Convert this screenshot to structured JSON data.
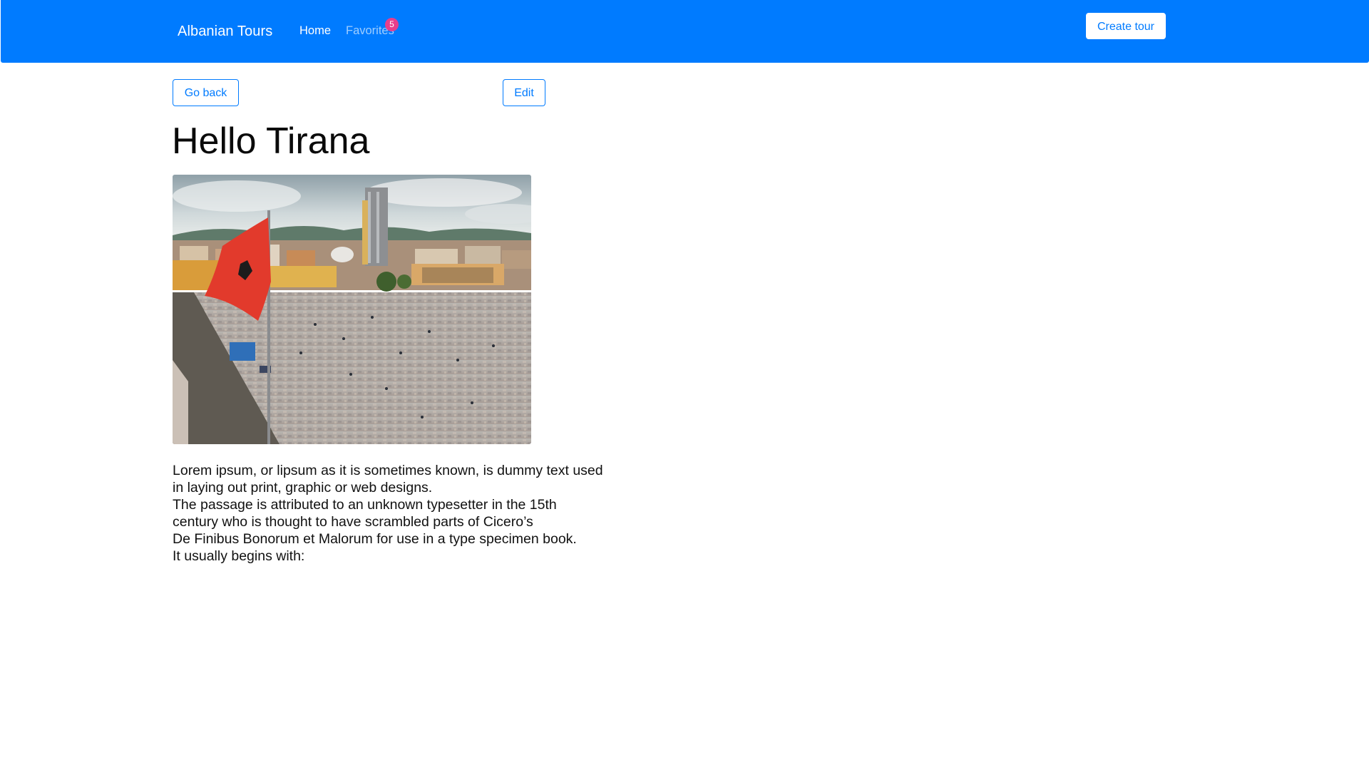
{
  "navbar": {
    "brand": "Albanian Tours",
    "links": [
      {
        "label": "Home",
        "active": true
      },
      {
        "label": "Favorites",
        "active": false
      }
    ],
    "favorites_count": "5",
    "create_button": "Create tour",
    "color": "#007bff",
    "badge_color": "#e83e8c"
  },
  "actions": {
    "back_label": "Go back",
    "edit_label": "Edit"
  },
  "tour": {
    "title": "Hello Tirana",
    "image_alt": "Skanderbeg Square in Tirana with Albanian flag",
    "description_lines": [
      "Lorem ipsum, or lipsum as it is sometimes known, is dummy text used",
      "in laying out print, graphic or web designs.",
      "The passage is attributed to an unknown typesetter in the 15th",
      "century who is thought to have scrambled parts of Cicero’s",
      "De Finibus Bonorum et Malorum for use in a type specimen book.",
      "It usually begins with:"
    ]
  }
}
